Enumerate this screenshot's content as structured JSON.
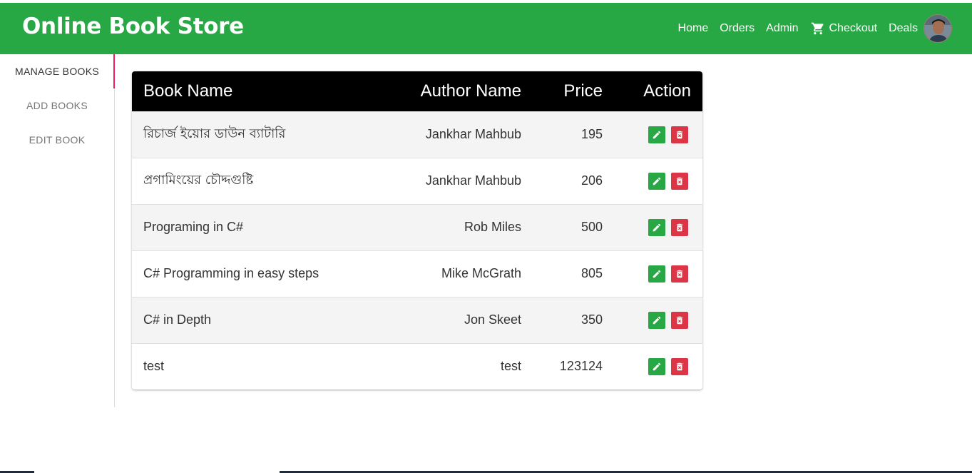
{
  "header": {
    "brand": "Online Book Store",
    "nav": [
      {
        "label": "Home"
      },
      {
        "label": "Orders"
      },
      {
        "label": "Admin"
      },
      {
        "label": "Checkout",
        "icon": "cart-icon"
      },
      {
        "label": "Deals"
      }
    ],
    "avatar_icon": "user-avatar"
  },
  "sidebar": {
    "items": [
      {
        "label": "MANAGE BOOKS",
        "active": true
      },
      {
        "label": "ADD BOOKS",
        "active": false
      },
      {
        "label": "EDIT BOOK",
        "active": false
      }
    ]
  },
  "table": {
    "headers": [
      "Book Name",
      "Author Name",
      "Price",
      "Action"
    ],
    "rows": [
      {
        "name": "রিচার্জ ইয়োর ডাউন ব্যাটারি",
        "author": "Jankhar Mahbub",
        "price": "195"
      },
      {
        "name": "প্রগামিংয়ের চৌদ্দগুষ্টি",
        "author": "Jankhar Mahbub",
        "price": "206"
      },
      {
        "name": "Programing in C#",
        "author": "Rob Miles",
        "price": "500"
      },
      {
        "name": "C# Programming in easy steps",
        "author": "Mike McGrath",
        "price": "805"
      },
      {
        "name": "C# in Depth",
        "author": "Jon Skeet",
        "price": "350"
      },
      {
        "name": "test",
        "author": "test",
        "price": "123124"
      }
    ],
    "action_icons": [
      "edit-icon",
      "delete-icon"
    ]
  },
  "colors": {
    "navbar": "#28a745",
    "table_header": "#000000",
    "edit_button": "#28a745",
    "delete_button": "#dc3545",
    "active_indicator": "#e91e63"
  }
}
